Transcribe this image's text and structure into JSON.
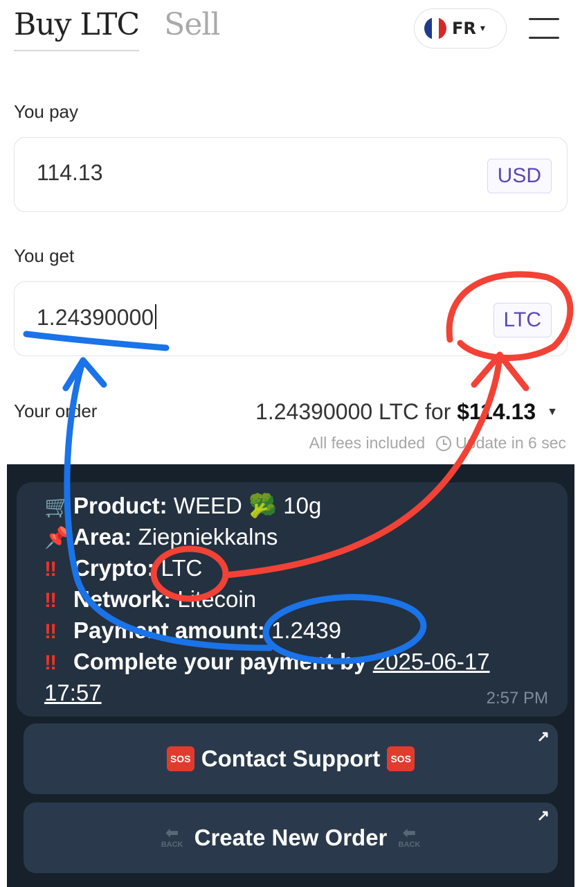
{
  "header": {
    "tab_buy": "Buy LTC",
    "tab_sell": "Sell",
    "language": "FR",
    "menu_icon": "hamburger-menu-icon",
    "flag_colors": [
      "#1e3a8a",
      "#ffffff",
      "#d62828"
    ]
  },
  "pay": {
    "label": "You pay",
    "value": "114.13",
    "currency": "USD"
  },
  "get": {
    "label": "You get",
    "value": "1.24390000",
    "currency": "LTC"
  },
  "order": {
    "label": "Your order",
    "summary_prefix": "1.24390000 LTC for ",
    "summary_price": "$114.13",
    "fees": "All fees included",
    "update": "Update in 6 sec"
  },
  "telegram": {
    "lines": [
      {
        "icon": "🛒",
        "key": "Product:",
        "value": " WEED 🥦 10g"
      },
      {
        "icon": "📌",
        "key": "Area:",
        "value": " Ziepniekkalns"
      },
      {
        "icon": "‼",
        "key": "Crypto:",
        "value": " LTC"
      },
      {
        "icon": "‼",
        "key": "Network:",
        "value": " Litecoin"
      },
      {
        "icon": "‼",
        "key": "Payment amount:",
        "value": " 1.2439"
      },
      {
        "icon": "‼",
        "key": "Complete your payment by",
        "value": " "
      }
    ],
    "deadline_date": "2025-06-17",
    "deadline_time": "17:57",
    "time": "2:57 PM",
    "buttons": {
      "contact_support": "Contact Support",
      "create_new_order": "Create New Order",
      "sos_label": "SOS",
      "back_label": "BACK"
    }
  },
  "annotation_colors": {
    "blue": "#1a73e8",
    "red": "#f24236"
  }
}
